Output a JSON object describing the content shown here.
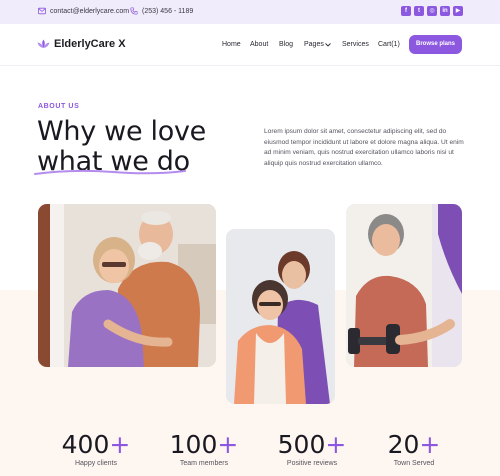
{
  "topbar": {
    "email": "contact@elderlycare.com",
    "phone": "(253) 456 - 1189",
    "social": [
      {
        "icon": "facebook-icon",
        "glyph": "f"
      },
      {
        "icon": "twitter-icon",
        "glyph": "t"
      },
      {
        "icon": "instagram-icon",
        "glyph": "◎"
      },
      {
        "icon": "linkedin-icon",
        "glyph": "in"
      },
      {
        "icon": "youtube-icon",
        "glyph": "▶"
      }
    ]
  },
  "nav": {
    "brand": "ElderlyCare X",
    "items": [
      "Home",
      "About",
      "Blog",
      "Pages",
      "Services",
      "Cart(1)"
    ],
    "cta": "Browse plans"
  },
  "hero": {
    "eyebrow": "ABOUT US",
    "title_line1": "Why we love",
    "title_line2": "what we do",
    "body": "Lorem ipsum dolor sit amet, consectetur adipiscing elit, sed do eiusmod tempor incididunt ut labore et dolore magna aliqua. Ut enim ad minim veniam, quis nostrud exercitation ullamco laboris nisi ut aliquip quis nostrud exercitation ullamco."
  },
  "stats": [
    {
      "value": "400",
      "suffix": "+",
      "label": "Happy clients"
    },
    {
      "value": "100",
      "suffix": "+",
      "label": "Team members"
    },
    {
      "value": "500",
      "suffix": "+",
      "label": "Positive reviews"
    },
    {
      "value": "20",
      "suffix": "+",
      "label": "Town Served"
    }
  ],
  "colors": {
    "accent": "#8d58e0",
    "topbar_bg": "#f1ecfb",
    "band_bg": "#fdf6f1"
  }
}
